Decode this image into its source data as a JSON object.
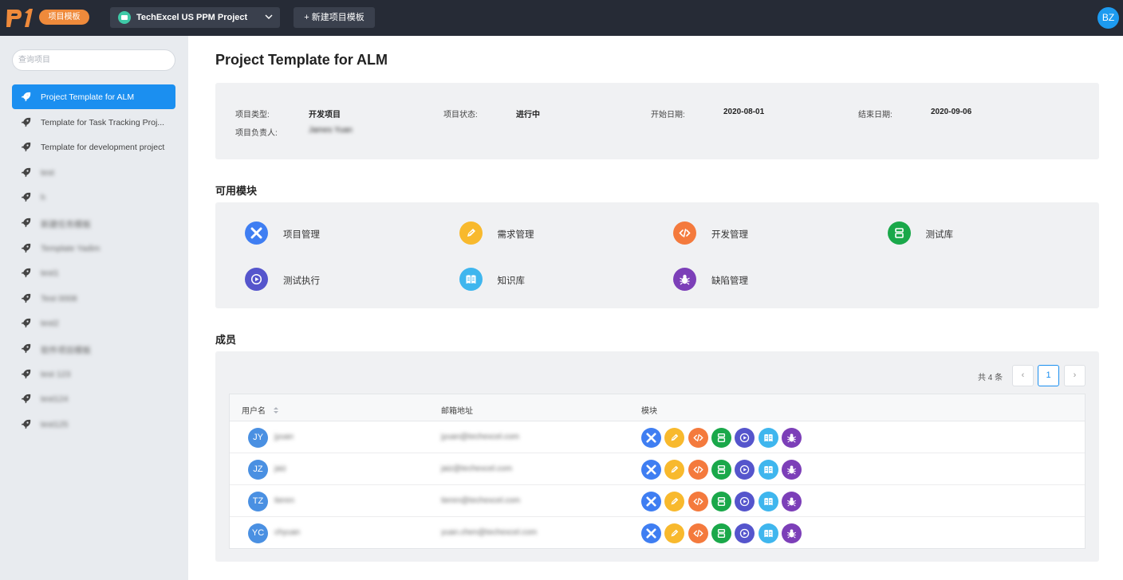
{
  "topbar": {
    "badge": "项目模板",
    "project_name": "TechExcel US PPM Project",
    "new_button": "+ 新建项目模板",
    "user_initials": "BZ"
  },
  "sidebar": {
    "search_placeholder": "查询项目",
    "items": [
      {
        "label": "Project Template for ALM",
        "active": true
      },
      {
        "label": "Template for Task Tracking Proj..."
      },
      {
        "label": "Template for development project"
      },
      {
        "label": "test"
      },
      {
        "label": "h"
      },
      {
        "label": "新建任务模板"
      },
      {
        "label": "Template Yadim"
      },
      {
        "label": "test1"
      },
      {
        "label": "Test 0008"
      },
      {
        "label": "test2"
      },
      {
        "label": "软件项目模板"
      },
      {
        "label": "test 123"
      },
      {
        "label": "test124"
      },
      {
        "label": "test125"
      }
    ]
  },
  "main": {
    "title": "Project Template for ALM",
    "info": {
      "type_label": "项目类型:",
      "type_value": "开发项目",
      "status_label": "项目状态:",
      "status_value": "进行中",
      "start_label": "开始日期:",
      "start_value": "2020-08-01",
      "end_label": "结束日期:",
      "end_value": "2020-09-06",
      "owner_label": "项目负责人:",
      "owner_value": "James Yuan"
    },
    "modules_title": "可用模块",
    "modules": [
      {
        "label": "项目管理",
        "icon": "project-icon",
        "color": "#3f7ef2"
      },
      {
        "label": "需求管理",
        "icon": "requirement-icon",
        "color": "#f8b92d"
      },
      {
        "label": "开发管理",
        "icon": "code-icon",
        "color": "#f47a3d"
      },
      {
        "label": "测试库",
        "icon": "test-library-icon",
        "color": "#1aa84a"
      },
      {
        "label": "测试执行",
        "icon": "play-icon",
        "color": "#5555cc"
      },
      {
        "label": "知识库",
        "icon": "book-icon",
        "color": "#3fb6ee"
      },
      {
        "label": "缺陷管理",
        "icon": "bug-icon",
        "color": "#7c3fb8"
      }
    ],
    "members_title": "成员",
    "pagination": {
      "total": "共 4 条",
      "prev": "‹",
      "current": "1",
      "next": "›"
    },
    "table": {
      "col_user": "用户名",
      "col_email": "邮箱地址",
      "col_modules": "模块",
      "rows": [
        {
          "initials": "JY",
          "name": "jyuan",
          "email": "jyuan@techexcel.com"
        },
        {
          "initials": "JZ",
          "name": "jaiz",
          "email": "jaiz@techexcel.com"
        },
        {
          "initials": "TZ",
          "name": "tieren",
          "email": "tieren@techexcel.com"
        },
        {
          "initials": "YC",
          "name": "chyuan",
          "email": "yuan.chen@techexcel.com"
        }
      ]
    }
  }
}
